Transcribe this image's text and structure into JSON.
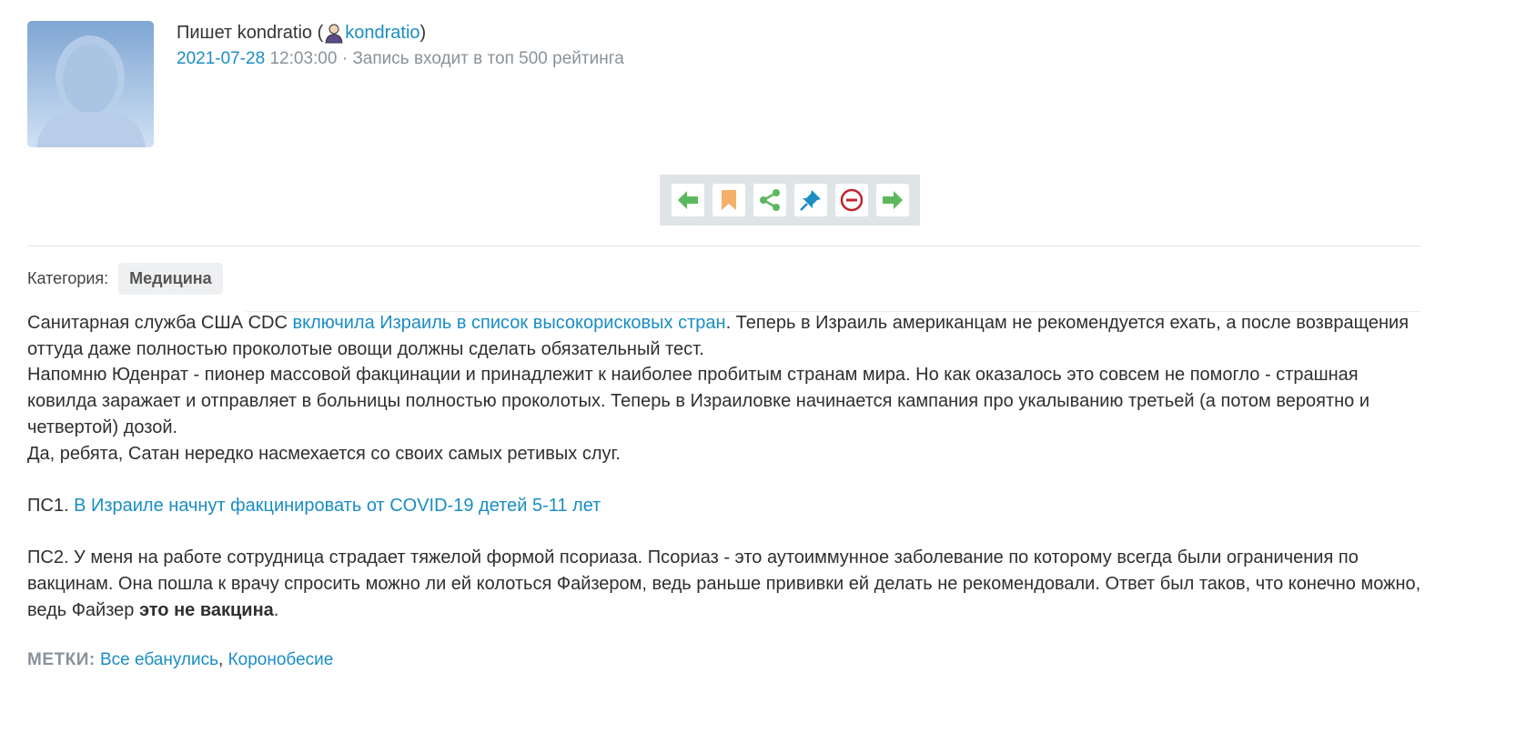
{
  "header": {
    "author_prefix": "Пишет kondratio (",
    "author_link": "kondratio",
    "author_suffix": ")",
    "date": "2021-07-28",
    "time": " 12:03:00 ·  ",
    "rating_note": "Запись входит в топ 500 рейтинга"
  },
  "toolbar": {
    "buttons": [
      {
        "icon": "arrow-left-icon",
        "color": "#5cb85c"
      },
      {
        "icon": "bookmark-icon",
        "color": "#f5b06a"
      },
      {
        "icon": "share-icon",
        "color": "#5cb85c"
      },
      {
        "icon": "pin-icon",
        "color": "#1a8dc5"
      },
      {
        "icon": "block-icon",
        "color": "#c0242b"
      },
      {
        "icon": "arrow-right-icon",
        "color": "#5cb85c"
      }
    ]
  },
  "category": {
    "label": "Категория:",
    "value": "Медицина"
  },
  "post": {
    "p1_before": "Санитарная служба США CDC ",
    "p1_link": "включила Израиль в список высокорисковых стран",
    "p1_after": ". Теперь в Израиль американцам не рекомендуется ехать, а после возвращения оттуда даже полностью проколотые овощи должны сделать обязательный тест.",
    "p2": "Напомню Юденрат - пионер массовой факцинации и принадлежит к наиболее пробитым странам мира. Но как оказалось это совсем не помогло - страшная ковилда заражает и отправляет в больницы полностью проколотых. Теперь в Израиловке начинается кампания про укалыванию третьей (а потом вероятно и четвертой) дозой.",
    "p3": "Да, ребята, Сатан нередко насмехается со своих самых ретивых слуг.",
    "ps1_prefix": "ПС1. ",
    "ps1_link": "В Израиле начнут факцинировать от COVID-19 детей 5-11 лет",
    "ps2_before": "ПС2. У меня на работе сотрудница страдает тяжелой формой псориаза. Псориаз - это аутоиммунное заболевание по которому всегда были ограничения по вакцинам. Она пошла к врачу спросить можно ли ей колоться Файзером, ведь раньше прививки ей делать не рекомендовали. Ответ был таков, что конечно можно, ведь Файзер ",
    "ps2_bold": "это не вакцина",
    "ps2_after": "."
  },
  "tags": {
    "label": "МЕТКИ:",
    "tag1": "Все ебанулись",
    "separator": ", ",
    "tag2": "Коронобесие"
  }
}
